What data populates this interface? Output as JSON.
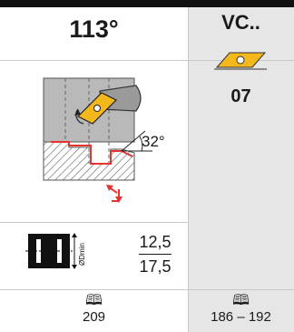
{
  "header": {
    "approach_angle": "113°",
    "insert_code": "VC..",
    "insert_size": "07"
  },
  "diagram": {
    "clearance_angle": "32°"
  },
  "bore": {
    "dmin_label": "ØDmin",
    "value_top": "12,5",
    "value_bottom": "17,5"
  },
  "references": {
    "left_pages": "209",
    "right_pages": "186 – 192"
  },
  "icons": {
    "book": "book-icon",
    "insert": "rhombic-insert-icon",
    "feed": "feed-direction-icon"
  },
  "colors": {
    "insert_yellow": "#f3b81c",
    "contour_red": "#e3342f",
    "panel_grey": "#e6e6e6"
  }
}
